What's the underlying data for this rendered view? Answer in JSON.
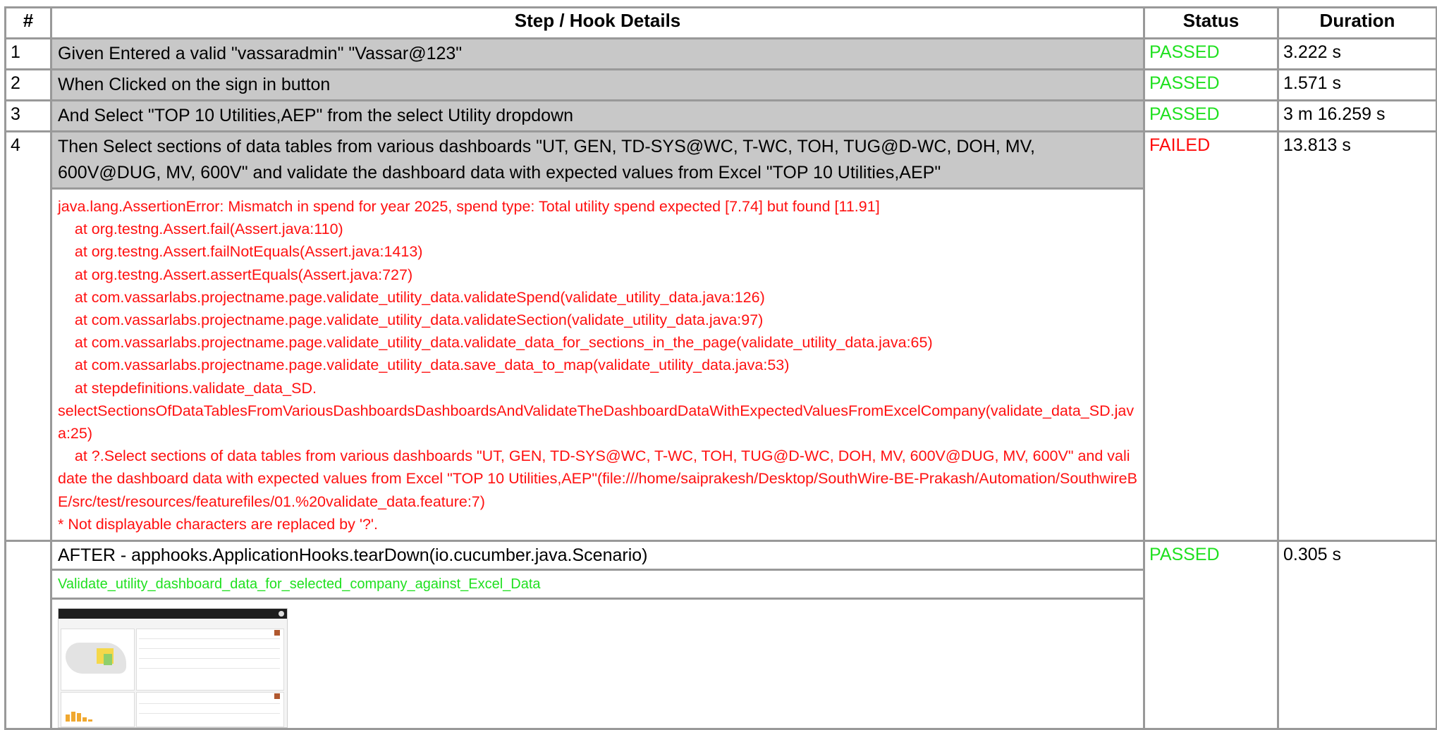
{
  "columns": {
    "num": "#",
    "details": "Step / Hook Details",
    "status": "Status",
    "duration": "Duration"
  },
  "steps": [
    {
      "num": "1",
      "text": "Given Entered a valid \"vassaradmin\" \"Vassar@123\"",
      "status": "PASSED",
      "duration": "3.222 s"
    },
    {
      "num": "2",
      "text": "When Clicked on the sign in button",
      "status": "PASSED",
      "duration": "1.571 s"
    },
    {
      "num": "3",
      "text": "And Select \"TOP 10 Utilities,AEP\" from the select Utility dropdown",
      "status": "PASSED",
      "duration": "3 m 16.259 s"
    },
    {
      "num": "4",
      "text": "Then Select sections of data tables from various dashboards \"UT, GEN, TD-SYS@WC, T-WC, TOH, TUG@D-WC, DOH, MV, 600V@DUG, MV, 600V\" and validate the dashboard data with expected values from Excel \"TOP 10 Utilities,AEP\"",
      "status": "FAILED",
      "duration": "13.813 s"
    }
  ],
  "error_lines": [
    "java.lang.AssertionError: Mismatch in spend for year 2025, spend type: Total utility spend expected [7.74] but found [11.91]",
    "    at org.testng.Assert.fail(Assert.java:110)",
    "    at org.testng.Assert.failNotEquals(Assert.java:1413)",
    "    at org.testng.Assert.assertEquals(Assert.java:727)",
    "    at com.vassarlabs.projectname.page.validate_utility_data.validateSpend(validate_utility_data.java:126)",
    "    at com.vassarlabs.projectname.page.validate_utility_data.validateSection(validate_utility_data.java:97)",
    "    at com.vassarlabs.projectname.page.validate_utility_data.validate_data_for_sections_in_the_page(validate_utility_data.java:65)",
    "    at com.vassarlabs.projectname.page.validate_utility_data.save_data_to_map(validate_utility_data.java:53)",
    "    at stepdefinitions.validate_data_SD.",
    "selectSectionsOfDataTablesFromVariousDashboardsDashboardsAndValidateTheDashboardDataWithExpectedValuesFromExcelCompany(validate_data_SD.java:25)",
    "    at ?.Select sections of data tables from various dashboards \"UT, GEN, TD-SYS@WC, T-WC, TOH, TUG@D-WC, DOH, MV, 600V@DUG, MV, 600V\" and validate the dashboard data with expected values from Excel \"TOP 10 Utilities,AEP\"(file:///home/saiprakesh/Desktop/SouthWire-BE-Prakash/Automation/SouthwireBE/src/test/resources/featurefiles/01.%20validate_data.feature:7)",
    "* Not displayable characters are replaced by '?'."
  ],
  "hook": {
    "text": "AFTER - apphooks.ApplicationHooks.tearDown(io.cucumber.java.Scenario)",
    "status": "PASSED",
    "duration": "0.305 s"
  },
  "scenario_name": "Validate_utility_dashboard_data_for_selected_company_against_Excel_Data",
  "colors": {
    "passed": "#1fe01f",
    "failed": "#ff0a0a",
    "step_bg": "#c8c8c8",
    "border": "#999999"
  }
}
